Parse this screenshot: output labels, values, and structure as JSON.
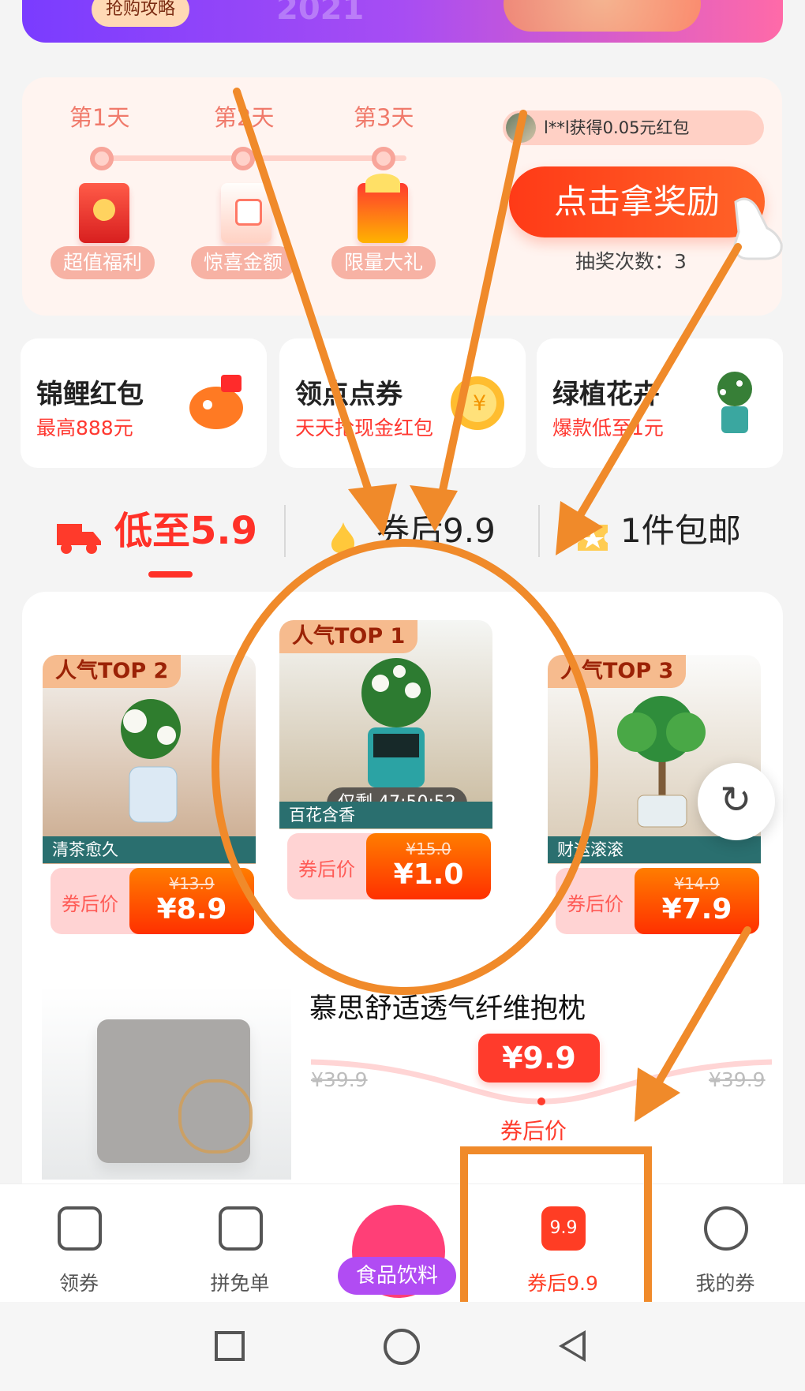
{
  "banner": {
    "button_label": "抢购攻略",
    "year": "2021"
  },
  "reward": {
    "days": [
      "第1天",
      "第2天",
      "第3天"
    ],
    "gift_labels": [
      "超值福利",
      "惊喜金额",
      "限量大礼"
    ],
    "notification": "l**l获得0.05元红包",
    "claim_label": "点击拿奖励",
    "lottery_text": "抽奖次数：3"
  },
  "mini_cards": [
    {
      "title": "锦鲤红包",
      "subtitle": "最高888元"
    },
    {
      "title": "领点点券",
      "subtitle": "天天抢现金红包"
    },
    {
      "title": "绿植花卉",
      "subtitle": "爆款低至1元"
    }
  ],
  "tabs": [
    "低至5.9",
    "券后9.9",
    "1件包邮"
  ],
  "products": [
    {
      "rank": "人气TOP 2",
      "caption": "清茶愈久",
      "price_label": "券后价",
      "old_price": "¥13.9",
      "new_price": "¥8.9"
    },
    {
      "rank": "人气TOP 1",
      "caption": "百花含香",
      "price_label": "券后价",
      "old_price": "¥15.0",
      "new_price": "¥1.0",
      "timer": "仅剩 47:50:52"
    },
    {
      "rank": "人气TOP 3",
      "caption": "财运滚滚",
      "price_label": "券后价",
      "old_price": "¥14.9",
      "new_price": "¥7.9"
    }
  ],
  "pillow": {
    "title": "慕思舒适透气纤维抱枕",
    "old_price_left": "¥39.9",
    "old_price_right": "¥39.9",
    "new_price": "¥9.9",
    "price_label": "券后价"
  },
  "bottom_nav": [
    {
      "label": "领券"
    },
    {
      "label": "拼免单"
    },
    {
      "label": "食品饮料"
    },
    {
      "label": "券后9.9",
      "icon_text": "9.9"
    },
    {
      "label": "我的券"
    }
  ],
  "colors": {
    "accent": "#ff3128",
    "annotation": "#f08a2a"
  }
}
